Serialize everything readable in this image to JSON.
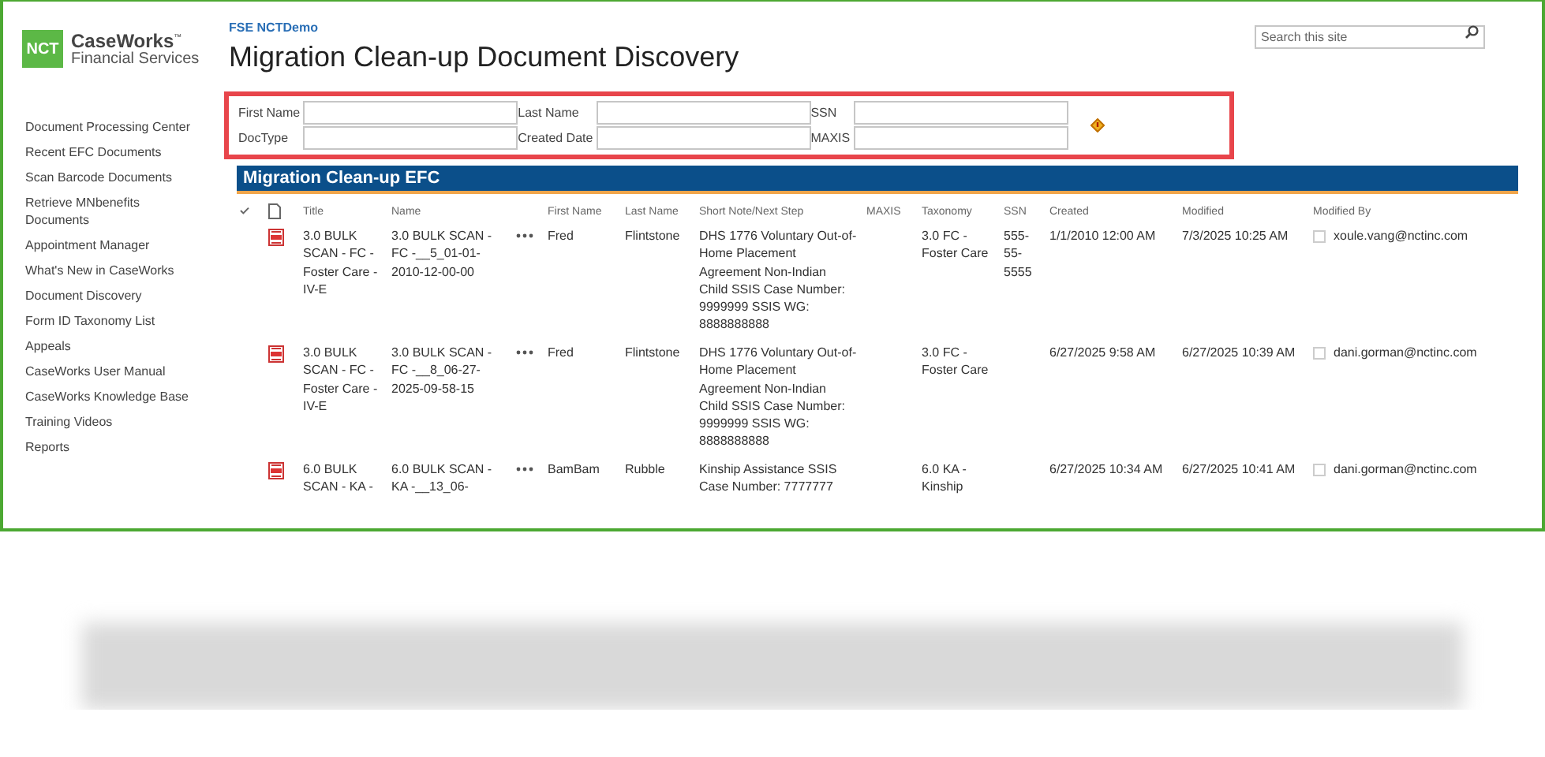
{
  "logo": {
    "badge": "NCT",
    "name": "CaseWorks",
    "trademark": "™",
    "subtitle": "Financial Services"
  },
  "site_link": "FSE NCTDemo",
  "page_title": "Migration Clean-up Document Discovery",
  "search": {
    "placeholder": "Search this site"
  },
  "nav": {
    "items": [
      {
        "label": "Document Processing Center"
      },
      {
        "label": "Recent EFC Documents"
      },
      {
        "label": "Scan Barcode Documents"
      },
      {
        "label": "Retrieve MNbenefits Documents"
      },
      {
        "label": "Appointment Manager"
      },
      {
        "label": "What's New in CaseWorks"
      },
      {
        "label": "Document Discovery"
      },
      {
        "label": "Form ID Taxonomy List"
      },
      {
        "label": "Appeals"
      },
      {
        "label": "CaseWorks User Manual"
      },
      {
        "label": "CaseWorks Knowledge Base"
      },
      {
        "label": "Training Videos"
      },
      {
        "label": "Reports"
      }
    ]
  },
  "filters": [
    {
      "label": "First Name"
    },
    {
      "label": "Last Name"
    },
    {
      "label": "SSN"
    },
    {
      "label": "DocType"
    },
    {
      "label": "Created Date"
    },
    {
      "label": "MAXIS"
    }
  ],
  "list": {
    "title": "Migration Clean-up EFC",
    "columns": [
      "Title",
      "Name",
      "First Name",
      "Last Name",
      "Short Note/Next Step",
      "MAXIS",
      "Taxonomy",
      "SSN",
      "Created",
      "Modified",
      "Modified By"
    ],
    "rows": [
      {
        "title": "3.0 BULK SCAN - FC - Foster Care - IV-E",
        "name": "3.0 BULK SCAN - FC -__5_01-01-2010-12-00-00",
        "first_name": "Fred",
        "last_name": "Flintstone",
        "short_note": "DHS 1776 Voluntary Out-of-Home Placement Agreement Non-Indian Child SSIS Case Number: 9999999 SSIS WG: 8888888888",
        "taxonomy": "3.0 FC - Foster Care",
        "ssn": "555-55-5555",
        "created": "1/1/2010 12:00 AM",
        "modified": "7/3/2025 10:25 AM",
        "modified_by": "xoule.vang@nctinc.com",
        "checked": false
      },
      {
        "title": "3.0 BULK SCAN - FC - Foster Care - IV-E",
        "name": "3.0 BULK SCAN - FC -__8_06-27-2025-09-58-15",
        "first_name": "Fred",
        "last_name": "Flintstone",
        "short_note": "DHS 1776 Voluntary Out-of-Home Placement Agreement Non-Indian Child SSIS Case Number: 9999999 SSIS WG: 8888888888",
        "taxonomy": "3.0 FC - Foster Care",
        "created": "6/27/2025 9:58 AM",
        "modified": "6/27/2025 10:39 AM",
        "modified_by": "dani.gorman@nctinc.com",
        "checked": false
      },
      {
        "title": "6.0 BULK SCAN - KA -",
        "name": "6.0 BULK SCAN - KA -__13_06-",
        "first_name": "BamBam",
        "last_name": "Rubble",
        "short_note": "Kinship Assistance SSIS Case Number: 7777777",
        "taxonomy": "6.0 KA - Kinship",
        "created": "6/27/2025 10:34 AM",
        "modified": "6/27/2025 10:41 AM",
        "modified_by": "dani.gorman@nctinc.com",
        "checked": false
      }
    ]
  }
}
